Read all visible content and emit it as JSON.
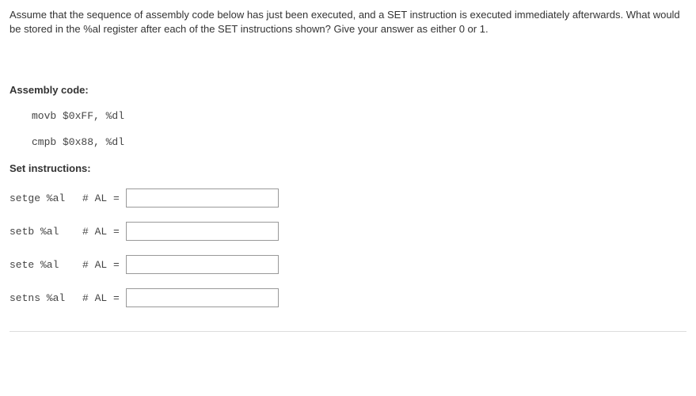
{
  "question": "Assume that the sequence of assembly code below has just been executed, and a SET instruction is executed immediately afterwards.  What would be stored in the %al register after each of the SET instructions shown?  Give your answer as either 0 or 1.",
  "labels": {
    "assembly_code": "Assembly code:",
    "set_instructions": "Set instructions:"
  },
  "code_lines": {
    "line1": "movb $0xFF, %dl",
    "line2": "cmpb $0x88, %dl"
  },
  "set_rows": [
    {
      "instr": "setge %al",
      "al_label": "# AL =",
      "value": ""
    },
    {
      "instr": "setb %al",
      "al_label": "# AL =",
      "value": ""
    },
    {
      "instr": "sete %al",
      "al_label": "# AL =",
      "value": ""
    },
    {
      "instr": "setns %al",
      "al_label": "# AL =",
      "value": ""
    }
  ]
}
